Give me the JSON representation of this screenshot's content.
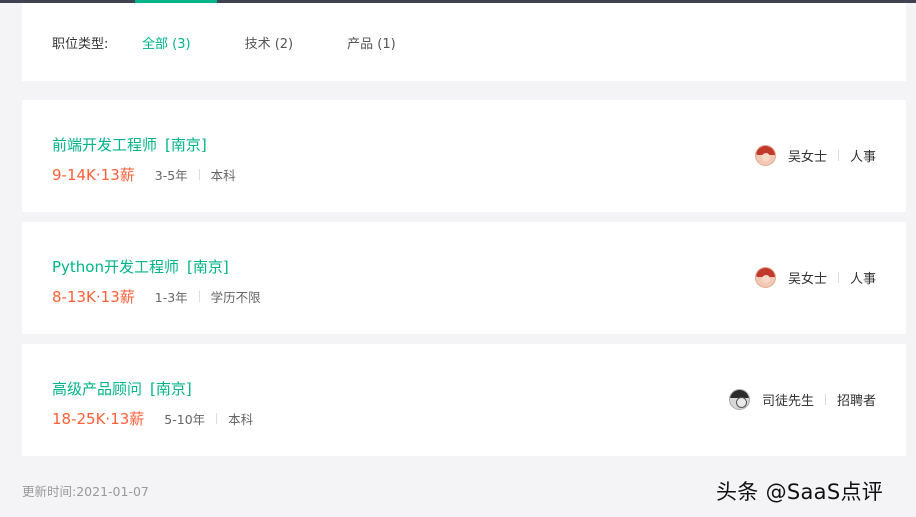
{
  "filters": {
    "label": "职位类型:",
    "options": [
      "全部 (3)",
      "技术 (2)",
      "产品 (1)"
    ],
    "active_index": 0
  },
  "jobs": [
    {
      "title": "前端开发工程师",
      "city": "[南京]",
      "salary": "9-14K·13薪",
      "experience": "3-5年",
      "education": "本科",
      "hr_name": "吴女士",
      "hr_role": "人事",
      "avatar": "female-avatar"
    },
    {
      "title": "Python开发工程师",
      "city": "[南京]",
      "salary": "8-13K·13薪",
      "experience": "1-3年",
      "education": "学历不限",
      "hr_name": "吴女士",
      "hr_role": "人事",
      "avatar": "female-avatar"
    },
    {
      "title": "高级产品顾问",
      "city": "[南京]",
      "salary": "18-25K·13薪",
      "experience": "5-10年",
      "education": "本科",
      "hr_name": "司徒先生",
      "hr_role": "招聘者",
      "avatar": "male-avatar"
    }
  ],
  "footer": {
    "update_time": "更新时间:2021-01-07"
  },
  "watermark": "头条 @SaaS点评",
  "colors": {
    "accent": "#00b38a",
    "salary": "#fd5f39",
    "topbar": "#3f4250"
  }
}
